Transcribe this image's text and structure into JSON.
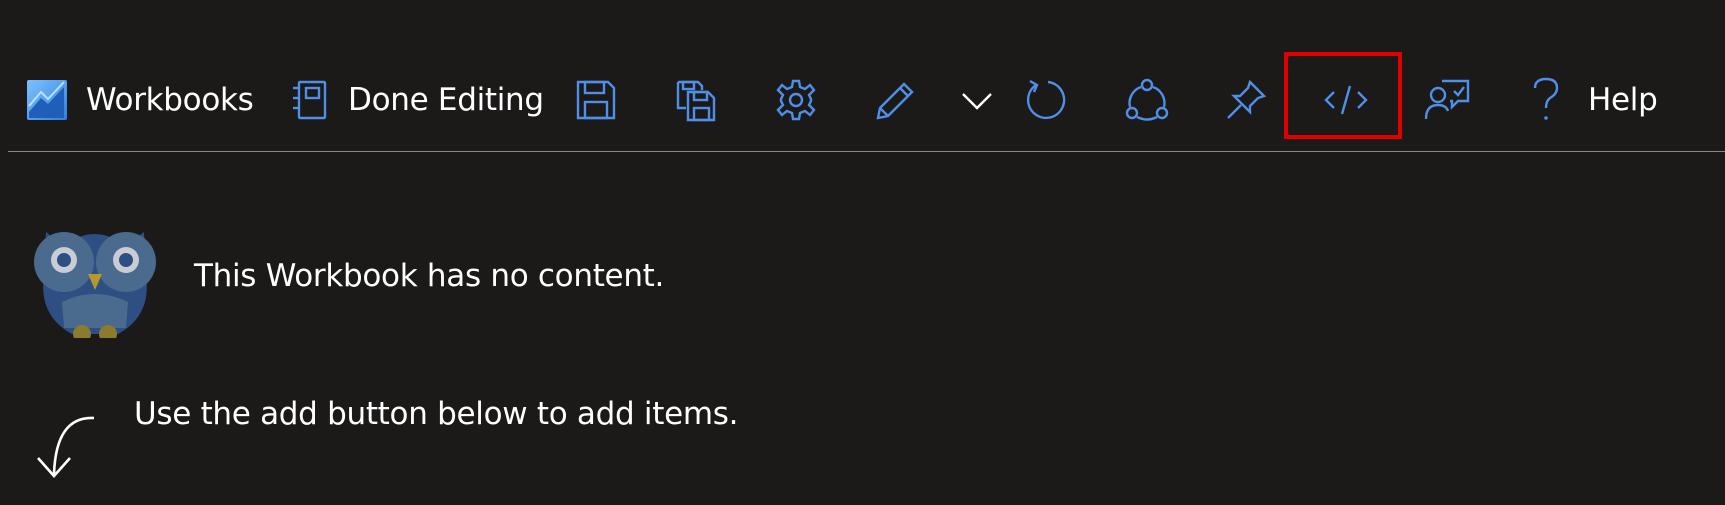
{
  "toolbar": {
    "app_label": "Workbooks",
    "done_editing_label": "Done Editing",
    "help_label": "Help",
    "icons": [
      "workbooks-icon",
      "done-editing-icon",
      "save-icon",
      "save-as-icon",
      "settings-icon",
      "edit-icon",
      "chevron-down-icon",
      "refresh-icon",
      "share-icon",
      "pin-icon",
      "code-icon",
      "feedback-icon",
      "help-icon"
    ],
    "highlight_color": "#e00000",
    "icon_color": "#4f8fe8"
  },
  "content": {
    "empty_title": "This Workbook has no content.",
    "empty_hint": "Use the add button below to add items."
  }
}
